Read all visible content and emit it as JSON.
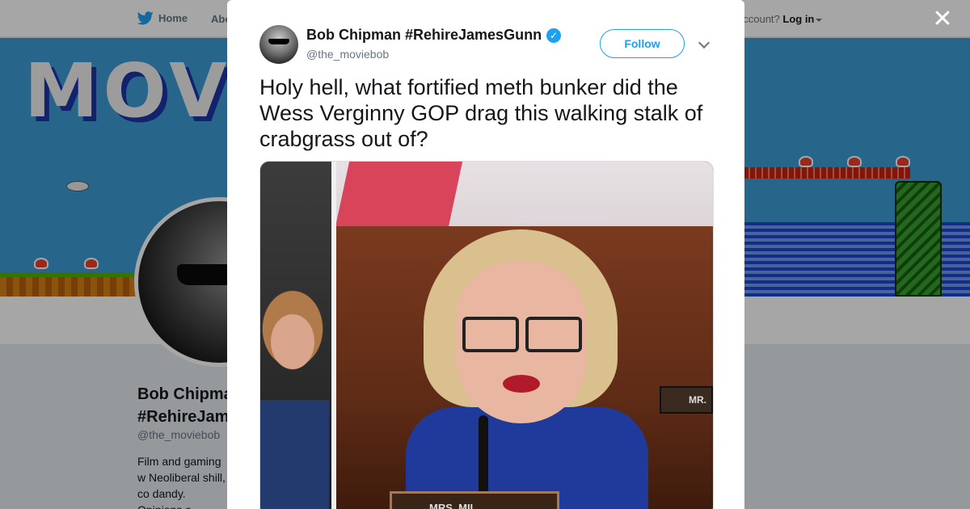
{
  "nav": {
    "home_label": "Home",
    "about_label": "Abo",
    "login_prompt": "account?",
    "login_label": "Log in"
  },
  "banner": {
    "title_text": "MOVI"
  },
  "profile": {
    "name": "Bob Chipman #RehireJames",
    "handle": "@the_moviebob",
    "bio": "Film and gaming w Neoliberal shill, co dandy. Opinions a employer(s), dub"
  },
  "tweet": {
    "author_name": "Bob Chipman #RehireJamesGunn",
    "verified_glyph": "✓",
    "author_handle": "@the_moviebob",
    "follow_label": "Follow",
    "text": "Holy hell, what fortified meth bunker did the Wess Verginny GOP drag this walking stalk of crabgrass out of?",
    "photo": {
      "placard_right": "MR.",
      "nameplate": "MRS. MIL"
    }
  },
  "close_glyph": "✕",
  "colors": {
    "accent": "#1da1f2",
    "text_primary": "#14171a",
    "text_secondary": "#657786"
  }
}
